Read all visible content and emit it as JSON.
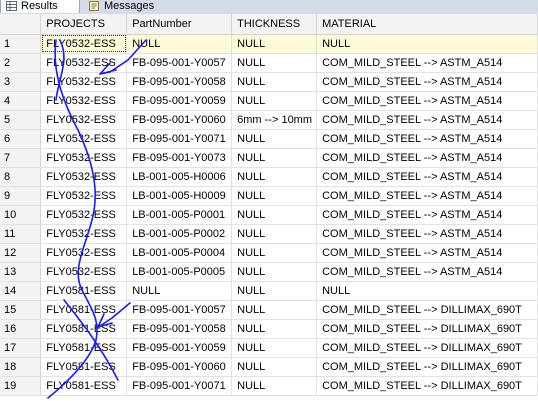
{
  "tabs": [
    {
      "label": "Results",
      "icon": "grid-icon"
    },
    {
      "label": "Messages",
      "icon": "messages-icon"
    }
  ],
  "columns": [
    "PROJECTS",
    "PartNumber",
    "THICKNESS",
    "MATERIAL"
  ],
  "rows": [
    {
      "n": "1",
      "projects": "FLY0532-ESS",
      "part": "NULL",
      "thick": "NULL",
      "material": "NULL"
    },
    {
      "n": "2",
      "projects": "FLY0532-ESS",
      "part": "FB-095-001-Y0057",
      "thick": "NULL",
      "material": "COM_MILD_STEEL --> ASTM_A514"
    },
    {
      "n": "3",
      "projects": "FLY0532-ESS",
      "part": "FB-095-001-Y0058",
      "thick": "NULL",
      "material": "COM_MILD_STEEL --> ASTM_A514"
    },
    {
      "n": "4",
      "projects": "FLY0532-ESS",
      "part": "FB-095-001-Y0059",
      "thick": "NULL",
      "material": "COM_MILD_STEEL --> ASTM_A514"
    },
    {
      "n": "5",
      "projects": "FLY0532-ESS",
      "part": "FB-095-001-Y0060",
      "thick": "6mm --> 10mm",
      "material": "COM_MILD_STEEL --> ASTM_A514"
    },
    {
      "n": "6",
      "projects": "FLY0532-ESS",
      "part": "FB-095-001-Y0071",
      "thick": "NULL",
      "material": "COM_MILD_STEEL --> ASTM_A514"
    },
    {
      "n": "7",
      "projects": "FLY0532-ESS",
      "part": "FB-095-001-Y0073",
      "thick": "NULL",
      "material": "COM_MILD_STEEL --> ASTM_A514"
    },
    {
      "n": "8",
      "projects": "FLY0532-ESS",
      "part": "LB-001-005-H0006",
      "thick": "NULL",
      "material": "COM_MILD_STEEL --> ASTM_A514"
    },
    {
      "n": "9",
      "projects": "FLY0532-ESS",
      "part": "LB-001-005-H0009",
      "thick": "NULL",
      "material": "COM_MILD_STEEL --> ASTM_A514"
    },
    {
      "n": "10",
      "projects": "FLY0532-ESS",
      "part": "LB-001-005-P0001",
      "thick": "NULL",
      "material": "COM_MILD_STEEL --> ASTM_A514"
    },
    {
      "n": "11",
      "projects": "FLY0532-ESS",
      "part": "LB-001-005-P0002",
      "thick": "NULL",
      "material": "COM_MILD_STEEL --> ASTM_A514"
    },
    {
      "n": "12",
      "projects": "FLY0532-ESS",
      "part": "LB-001-005-P0004",
      "thick": "NULL",
      "material": "COM_MILD_STEEL --> ASTM_A514"
    },
    {
      "n": "13",
      "projects": "FLY0532-ESS",
      "part": "LB-001-005-P0005",
      "thick": "NULL",
      "material": "COM_MILD_STEEL --> ASTM_A514"
    },
    {
      "n": "14",
      "projects": "FLY0581-ESS",
      "part": "NULL",
      "thick": "NULL",
      "material": "NULL"
    },
    {
      "n": "15",
      "projects": "FLY0581-ESS",
      "part": "FB-095-001-Y0057",
      "thick": "NULL",
      "material": "COM_MILD_STEEL --> DILLIMAX_690T"
    },
    {
      "n": "16",
      "projects": "FLY0581-ESS",
      "part": "FB-095-001-Y0058",
      "thick": "NULL",
      "material": "COM_MILD_STEEL --> DILLIMAX_690T"
    },
    {
      "n": "17",
      "projects": "FLY0581-ESS",
      "part": "FB-095-001-Y0059",
      "thick": "NULL",
      "material": "COM_MILD_STEEL --> DILLIMAX_690T"
    },
    {
      "n": "18",
      "projects": "FLY0581-ESS",
      "part": "FB-095-001-Y0060",
      "thick": "NULL",
      "material": "COM_MILD_STEEL --> DILLIMAX_690T"
    },
    {
      "n": "19",
      "projects": "FLY0581-ESS",
      "part": "FB-095-001-Y0071",
      "thick": "NULL",
      "material": "COM_MILD_STEEL --> DILLIMAX_690T"
    }
  ],
  "colors": {
    "selected_row": "#fefcd8",
    "header_bg": "#f3f3f3",
    "annotation": "#1a1aff"
  }
}
